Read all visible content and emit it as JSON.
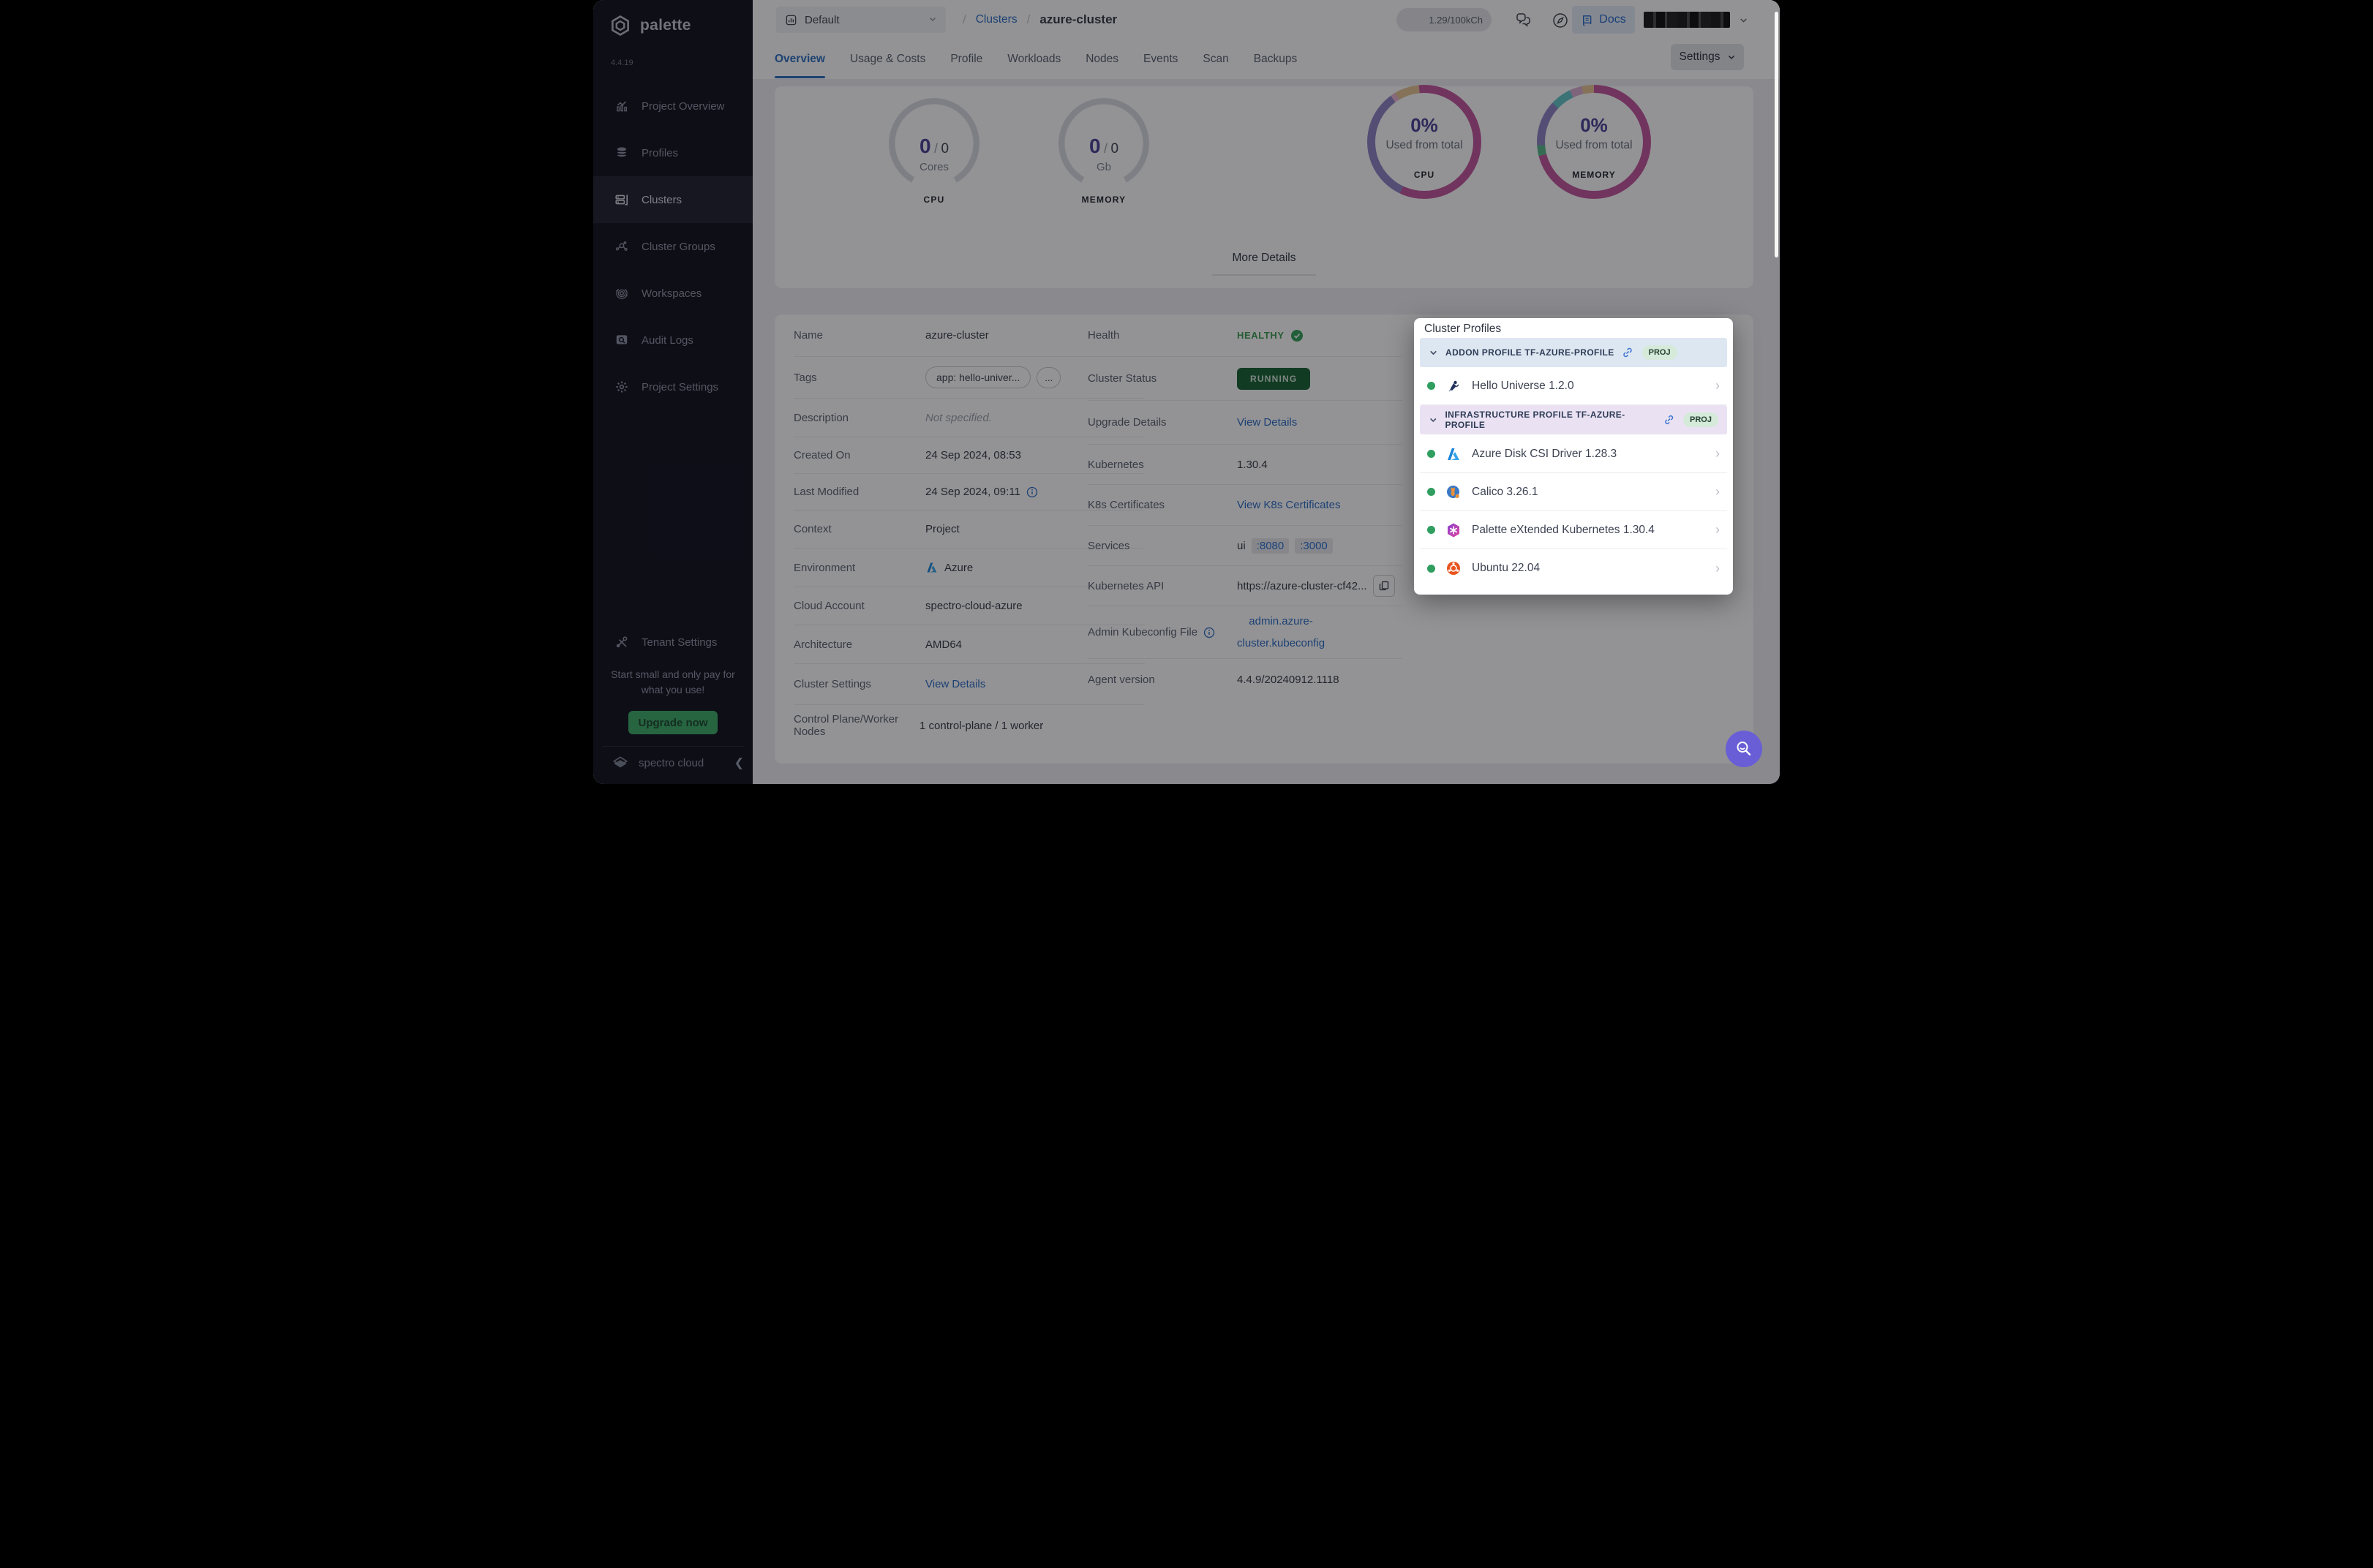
{
  "sidebar": {
    "logo_text": "palette",
    "version": "4.4.19",
    "items": [
      {
        "label": "Project Overview",
        "icon": "chart-icon"
      },
      {
        "label": "Profiles",
        "icon": "layers-icon"
      },
      {
        "label": "Clusters",
        "icon": "servers-icon"
      },
      {
        "label": "Cluster Groups",
        "icon": "network-icon"
      },
      {
        "label": "Workspaces",
        "icon": "orbit-icon"
      },
      {
        "label": "Audit Logs",
        "icon": "audit-icon"
      },
      {
        "label": "Project Settings",
        "icon": "gear-icon"
      }
    ],
    "tenant_settings": "Tenant Settings",
    "promo": {
      "text": "Start small and only pay for what you use!",
      "button": "Upgrade now"
    },
    "brand": "spectro cloud"
  },
  "header": {
    "project_selector": "Default",
    "breadcrumb": {
      "separator": "/",
      "root": "Clusters",
      "current": "azure-cluster"
    },
    "usage": "1.29/100kCh",
    "docs": "Docs",
    "settings": "Settings",
    "tabs": [
      {
        "label": "Overview"
      },
      {
        "label": "Usage & Costs"
      },
      {
        "label": "Profile"
      },
      {
        "label": "Workloads"
      },
      {
        "label": "Nodes"
      },
      {
        "label": "Events"
      },
      {
        "label": "Scan"
      },
      {
        "label": "Backups"
      }
    ]
  },
  "summary": {
    "gauges": [
      {
        "used": "0",
        "sep": "/",
        "total": "0",
        "unit": "Cores",
        "label": "CPU"
      },
      {
        "used": "0",
        "sep": "/",
        "total": "0",
        "unit": "Gb",
        "label": "MEMORY"
      }
    ],
    "donuts": [
      {
        "percent": "0%",
        "caption": "Used from total",
        "label": "CPU",
        "segments": [
          {
            "color": "#c2569e",
            "pct": 57
          },
          {
            "color": "#8f84c6",
            "pct": 33
          },
          {
            "color": "#e8b7d2",
            "pct": 1.5
          },
          {
            "color": "#e6c492",
            "pct": 7
          },
          {
            "color": "#c2569e",
            "pct": 1.5
          }
        ]
      },
      {
        "percent": "0%",
        "caption": "Used from total",
        "label": "MEMORY",
        "segments": [
          {
            "color": "#c2569e",
            "pct": 71
          },
          {
            "color": "#59b98c",
            "pct": 3
          },
          {
            "color": "#8f84c6",
            "pct": 13
          },
          {
            "color": "#63c6c9",
            "pct": 6
          },
          {
            "color": "#d9aed3",
            "pct": 3.5
          },
          {
            "color": "#e6c492",
            "pct": 3.5
          }
        ]
      }
    ],
    "more_details": "More Details"
  },
  "details": {
    "left": {
      "name_label": "Name",
      "name_value": "azure-cluster",
      "tags_label": "Tags",
      "tag1": "app: hello-univer...",
      "tag2": "...",
      "description_label": "Description",
      "description_value": "Not specified.",
      "created_label": "Created On",
      "created_value": "24 Sep 2024, 08:53",
      "modified_label": "Last Modified",
      "modified_value": "24 Sep 2024, 09:11",
      "context_label": "Context",
      "context_value": "Project",
      "environment_label": "Environment",
      "environment_value": "Azure",
      "cloud_label": "Cloud Account",
      "cloud_value": "spectro-cloud-azure",
      "arch_label": "Architecture",
      "arch_value": "AMD64",
      "settings_label": "Cluster Settings",
      "settings_link": "View Details",
      "nodes_label": "Control Plane/Worker Nodes",
      "nodes_value": "1 control-plane / 1 worker"
    },
    "right": {
      "health_label": "Health",
      "health_value": "HEALTHY",
      "status_label": "Cluster Status",
      "status_value": "RUNNING",
      "upgrade_label": "Upgrade Details",
      "upgrade_link": "View Details",
      "k8s_label": "Kubernetes",
      "k8s_value": "1.30.4",
      "certs_label": "K8s Certificates",
      "certs_link": "View K8s Certificates",
      "services_label": "Services",
      "services_prefix": "ui",
      "service_port1": ":8080",
      "service_port2": ":3000",
      "api_label": "Kubernetes API",
      "api_value": "https://azure-cluster-cf42...",
      "kubeconfig_label": "Admin Kubeconfig File",
      "kubeconfig_line1": "admin.azure-",
      "kubeconfig_line2": "cluster.kubeconfig",
      "agent_label": "Agent version",
      "agent_value": "4.4.9/20240912.1118"
    }
  },
  "popup": {
    "title": "Cluster Profiles",
    "badge": "PROJ",
    "addon_header": "ADDON PROFILE TF-AZURE-PROFILE",
    "infra_header": "INFRASTRUCTURE PROFILE TF-AZURE-PROFILE",
    "addon_items": [
      {
        "name": "Hello Universe 1.2.0",
        "icon": "hello-universe-icon"
      }
    ],
    "infra_items": [
      {
        "name": "Azure Disk CSI Driver 1.28.3",
        "icon": "azure-icon"
      },
      {
        "name": "Calico 3.26.1",
        "icon": "calico-icon"
      },
      {
        "name": "Palette eXtended Kubernetes 1.30.4",
        "icon": "pxk-icon"
      },
      {
        "name": "Ubuntu 22.04",
        "icon": "ubuntu-icon"
      }
    ]
  },
  "colors": {
    "accent_purple": "#4b4397",
    "link_blue": "#2b6cc4",
    "healthy_green": "#3f9e52",
    "running_bg": "#1a6234",
    "status_dot_green": "#2f9e5f",
    "fab_indigo": "#695ed6",
    "sidebar_bg": "#13131f",
    "upgrade_green": "#3fae6a"
  }
}
